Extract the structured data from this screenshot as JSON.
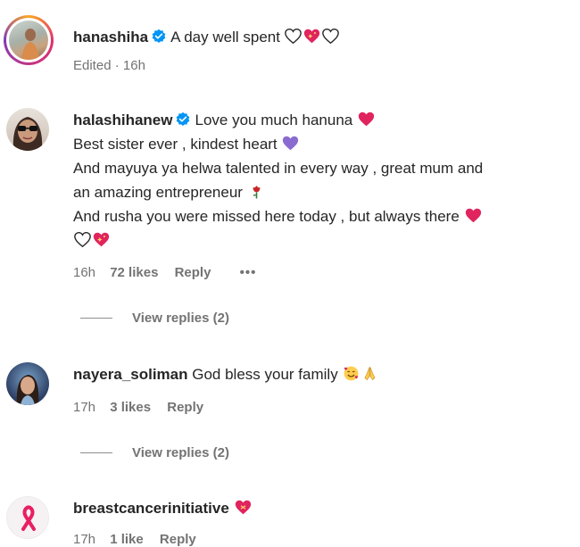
{
  "post_caption": {
    "username": "hanashiha",
    "text": "A day well spent",
    "edited_label": "Edited",
    "time": "16h",
    "emojis": [
      "white-heart-icon",
      "sparkling-heart-icon",
      "white-heart-icon"
    ]
  },
  "comments": [
    {
      "username": "halashihanew",
      "verified": true,
      "lines": [
        "Love you much hanuna",
        "Best sister ever , kindest heart",
        "And mayuya ya helwa talented in every way , great mum and",
        "an amazing entrepreneur",
        "And rusha you were missed here today , but always there"
      ],
      "time": "16h",
      "likes": "72 likes",
      "reply_label": "Reply",
      "more_label": "•••",
      "view_replies": "View replies (2)"
    },
    {
      "username": "nayera_soliman",
      "text": "God bless your family",
      "time": "17h",
      "likes": "3 likes",
      "reply_label": "Reply",
      "view_replies": "View replies (2)"
    },
    {
      "username": "breastcancerinitiative",
      "time": "17h",
      "likes": "1 like",
      "reply_label": "Reply"
    }
  ],
  "colors": {
    "verified_blue": "#0095f6",
    "red_heart": "#e0245e",
    "purple_heart": "#8a6cd1",
    "story_ring_start": "#f9a825",
    "story_ring_end": "#d6249f"
  }
}
